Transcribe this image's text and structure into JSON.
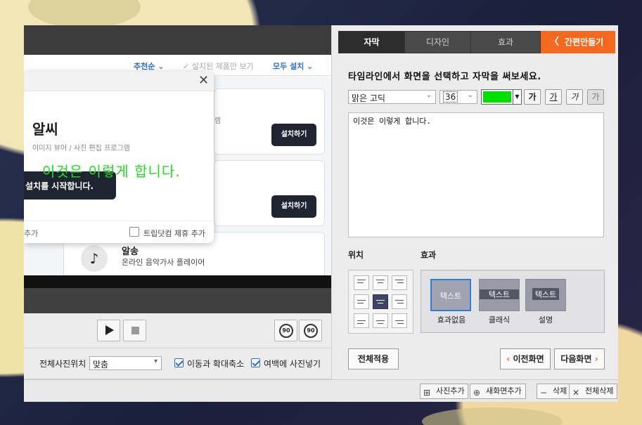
{
  "colors": {
    "accent": "#f4691f",
    "caption_green": "#22dd22",
    "selection_blue": "#2e7ed8",
    "dark_button": "#1f2530"
  },
  "preview": {
    "filter": {
      "sort_label": "추천순",
      "installed_only_label": "설치된 제품만 보기",
      "install_all_label": "모두 설치"
    },
    "dialog": {
      "close_glyph": "✕",
      "app_name": "알씨",
      "app_description": "이미지 뷰어 / 사진 편집 프로그램",
      "start_button": "설치를 시작합니다.",
      "footer_left": "추가",
      "footer_checkbox_label": "트립닷컴 제휴 추가"
    },
    "cards": [
      {
        "desc_fragment": "램",
        "button": "설치하기"
      },
      {
        "desc_fragment": "",
        "button": "설치하기"
      }
    ],
    "card3": {
      "name": "알송",
      "description": "온라인 음악가사 플레이어"
    },
    "overlay_caption": "이것은 이렇게 합니다."
  },
  "player": {
    "play_icon": "play-icon",
    "stop_icon": "stop-icon",
    "rewind_label": "90",
    "forward_label": "90"
  },
  "options": {
    "photo_position_label": "전체사진위치",
    "photo_position_value": "맞춤",
    "move_zoom_label": "이동과 확대축소",
    "fill_margin_label": "여백에 사진넣기"
  },
  "right": {
    "tabs": [
      {
        "label": "자막",
        "active": true
      },
      {
        "label": "디자인",
        "active": false
      },
      {
        "label": "효과",
        "active": false
      }
    ],
    "quick_button": "간편만들기",
    "hint": "타임라인에서 화면을 선택하고 자막을 써보세요.",
    "font_name": "맑은 고딕",
    "font_size": "36",
    "text_color": "#00e000",
    "style_buttons": [
      "가",
      "가",
      "가",
      "가"
    ],
    "caption_text": "이것은 이렇게 합니다.",
    "position_label": "위치",
    "effect_label": "효과",
    "effects": [
      {
        "sample": "텍스트",
        "label": "효과없음",
        "selected": true
      },
      {
        "sample": "텍스트",
        "label": "클래식",
        "selected": false
      },
      {
        "sample": "텍스트",
        "label": "설명",
        "selected": false
      }
    ],
    "apply_all": "전체적용",
    "prev_screen": "이전화면",
    "next_screen": "다음화면"
  },
  "bottombar": {
    "add_photo": "사진추가",
    "add_new_screen": "새화면추가",
    "delete": "삭제",
    "delete_all": "전체삭제"
  }
}
